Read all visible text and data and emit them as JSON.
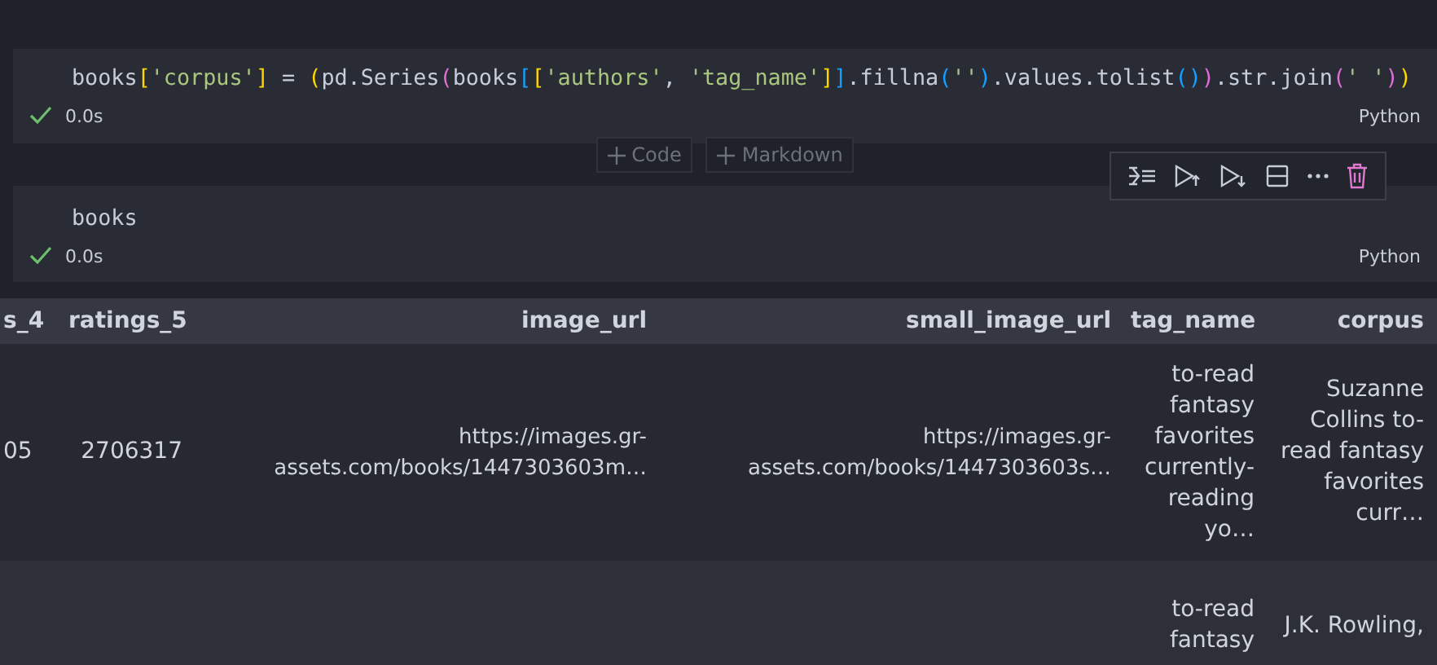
{
  "cells": [
    {
      "code": [
        {
          "kind": "text",
          "t": "books"
        },
        {
          "kind": "b1",
          "t": "["
        },
        {
          "kind": "string",
          "t": "'corpus'"
        },
        {
          "kind": "b1",
          "t": "]"
        },
        {
          "kind": "text",
          "t": " = "
        },
        {
          "kind": "b1",
          "t": "("
        },
        {
          "kind": "text",
          "t": "pd.Series"
        },
        {
          "kind": "b2",
          "t": "("
        },
        {
          "kind": "text",
          "t": "books"
        },
        {
          "kind": "b3",
          "t": "["
        },
        {
          "kind": "b1",
          "t": "["
        },
        {
          "kind": "string",
          "t": "'authors'"
        },
        {
          "kind": "text",
          "t": ", "
        },
        {
          "kind": "string",
          "t": "'tag_name'"
        },
        {
          "kind": "b1",
          "t": "]"
        },
        {
          "kind": "b3",
          "t": "]"
        },
        {
          "kind": "text",
          "t": ".fillna"
        },
        {
          "kind": "b3",
          "t": "("
        },
        {
          "kind": "string",
          "t": "''"
        },
        {
          "kind": "b3",
          "t": ")"
        },
        {
          "kind": "text",
          "t": ".values.tolist"
        },
        {
          "kind": "b3",
          "t": "("
        },
        {
          "kind": "b3",
          "t": ")"
        },
        {
          "kind": "b2",
          "t": ")"
        },
        {
          "kind": "text",
          "t": ".str.join"
        },
        {
          "kind": "b2",
          "t": "("
        },
        {
          "kind": "string",
          "t": "' '"
        },
        {
          "kind": "b2",
          "t": ")"
        },
        {
          "kind": "b1",
          "t": ")"
        }
      ],
      "success": true,
      "time": "0.0s",
      "language": "Python"
    },
    {
      "code": [
        {
          "kind": "text",
          "t": "books"
        }
      ],
      "success": true,
      "time": "0.0s",
      "language": "Python"
    }
  ],
  "add_buttons": [
    "Code",
    "Markdown"
  ],
  "table": {
    "columns": [
      "s_4",
      "ratings_5",
      "image_url",
      "small_image_url",
      "tag_name",
      "corpus"
    ],
    "rows": [
      [
        "05",
        "2706317",
        "https://images.gr-assets.com/books/1447303603m…",
        "https://images.gr-assets.com/books/1447303603s…",
        "to-read fantasy favorites currently-reading yo…",
        "Suzanne Collins to-read fantasy favorites curr…"
      ],
      [
        "",
        "",
        "",
        "",
        "to-read fantasy",
        "J.K. Rowling,"
      ]
    ]
  }
}
